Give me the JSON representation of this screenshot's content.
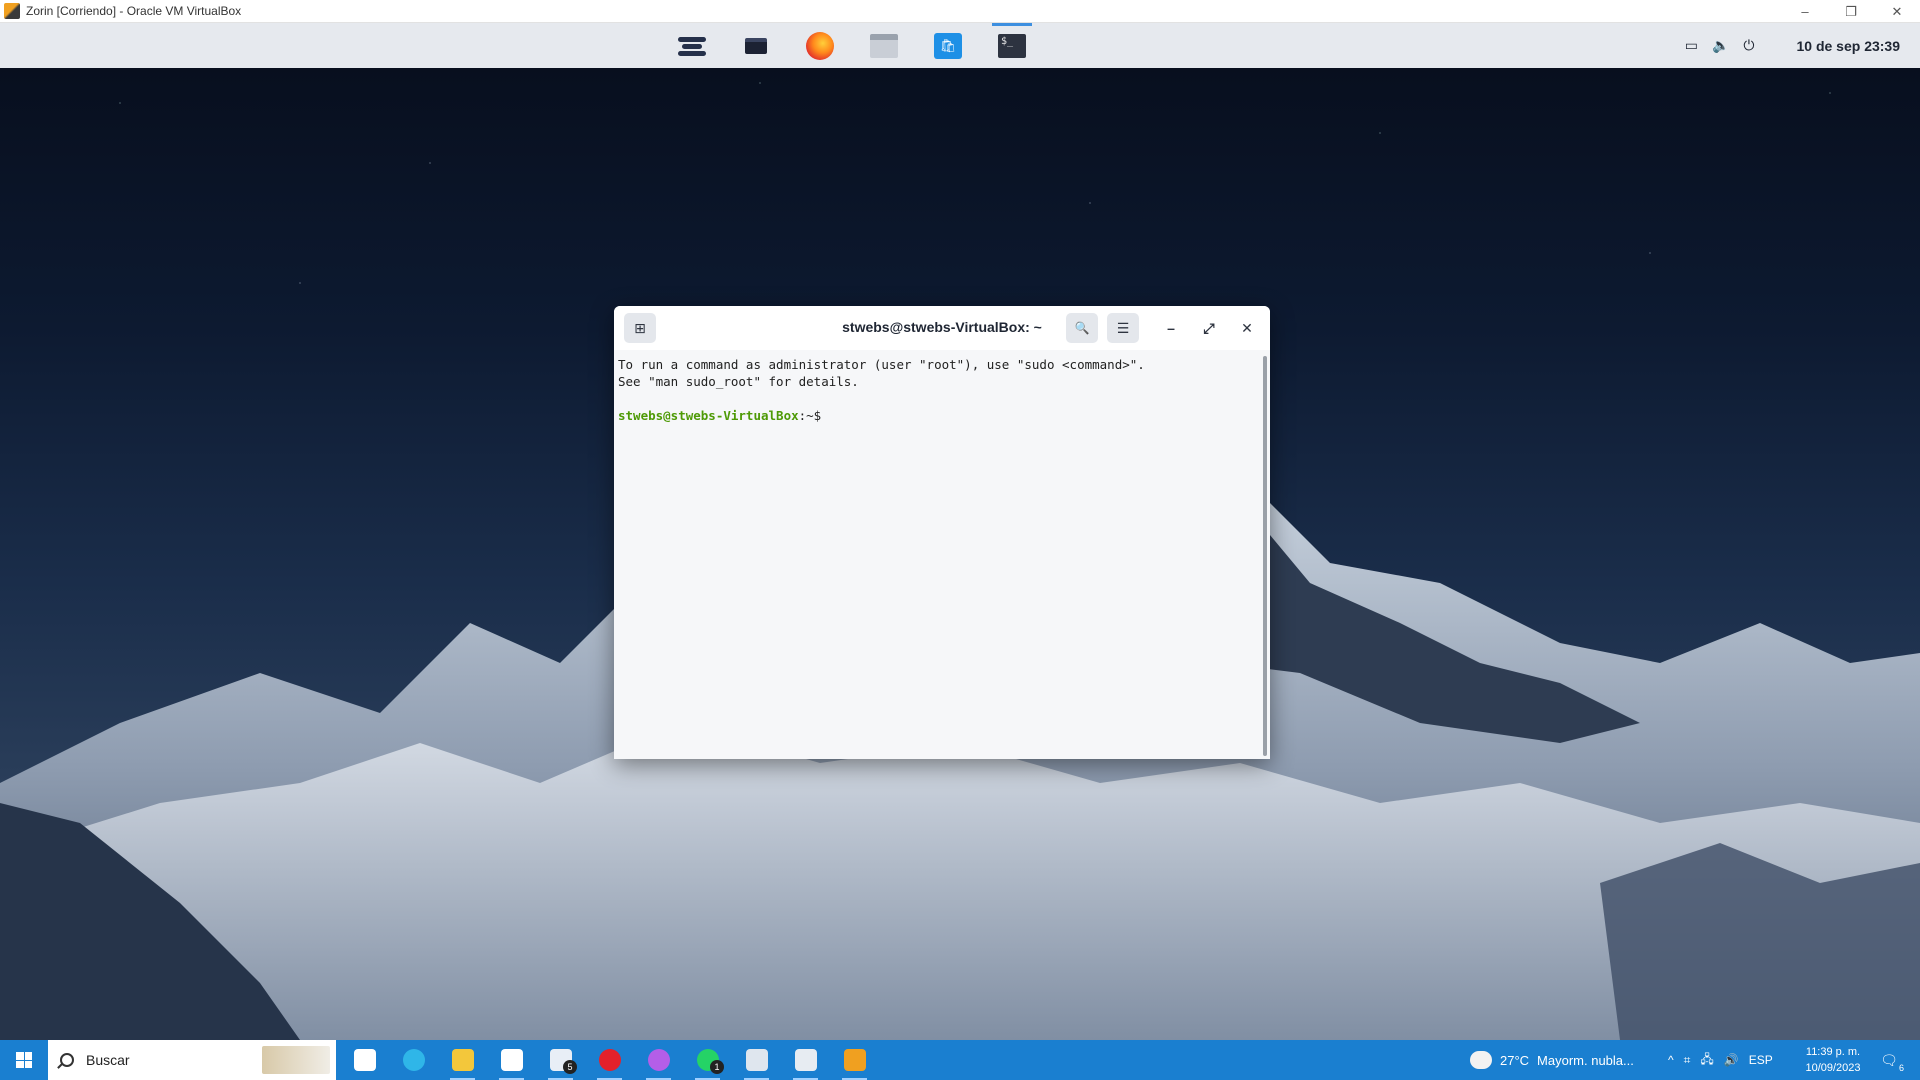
{
  "host_window": {
    "title": "Zorin [Corriendo] - Oracle VM VirtualBox",
    "controls": {
      "minimize": "–",
      "restore": "❐",
      "close": "✕"
    }
  },
  "zorin_panel": {
    "dock": [
      {
        "name": "zorin-menu",
        "icon": "zorin-logo-icon"
      },
      {
        "name": "workspaces",
        "icon": "window-icon"
      },
      {
        "name": "firefox",
        "icon": "firefox-icon"
      },
      {
        "name": "files",
        "icon": "folder-icon"
      },
      {
        "name": "software",
        "icon": "store-icon"
      },
      {
        "name": "terminal",
        "icon": "terminal-icon",
        "active": true
      }
    ],
    "tray": {
      "display_icon": "▭",
      "volume_icon": "🔈",
      "power_icon": "⏻"
    },
    "clock": "10 de sep  23:39"
  },
  "terminal": {
    "title": "stwebs@stwebs-VirtualBox: ~",
    "new_tab_glyph": "⊞",
    "search_glyph": "🔍",
    "menu_glyph": "☰",
    "minimize_glyph": "–",
    "maximize_glyph": "⤢",
    "close_glyph": "✕",
    "lines": [
      "To run a command as administrator (user \"root\"), use \"sudo <command>\".",
      "See \"man sudo_root\" for details."
    ],
    "prompt_user": "stwebs@stwebs-VirtualBox",
    "prompt_suffix": ":~$"
  },
  "windows_taskbar": {
    "search_placeholder": "Buscar",
    "apps": [
      {
        "name": "task-view",
        "color": "#ffffff"
      },
      {
        "name": "edge",
        "color": "#2fb6e8"
      },
      {
        "name": "file-explorer",
        "color": "#f3c73b"
      },
      {
        "name": "ms-store",
        "color": "#ffffff"
      },
      {
        "name": "mail",
        "color": "#e8eef6",
        "badge": "5"
      },
      {
        "name": "opera",
        "color": "#e3212b"
      },
      {
        "name": "messenger",
        "color": "#b45ee8"
      },
      {
        "name": "whatsapp",
        "color": "#25d366",
        "badge": "1"
      },
      {
        "name": "notepad",
        "color": "#dfe6ee"
      },
      {
        "name": "virtualbox-box",
        "color": "#e7ecf2"
      },
      {
        "name": "virtualbox-vm",
        "color": "#f0a020"
      }
    ],
    "weather": {
      "temp": "27°C",
      "desc": "Mayorm. nubla..."
    },
    "tray": {
      "chevron": "^",
      "lang": "ESP"
    },
    "time": "11:39 p. m.",
    "date": "10/09/2023",
    "notifications": "6"
  }
}
